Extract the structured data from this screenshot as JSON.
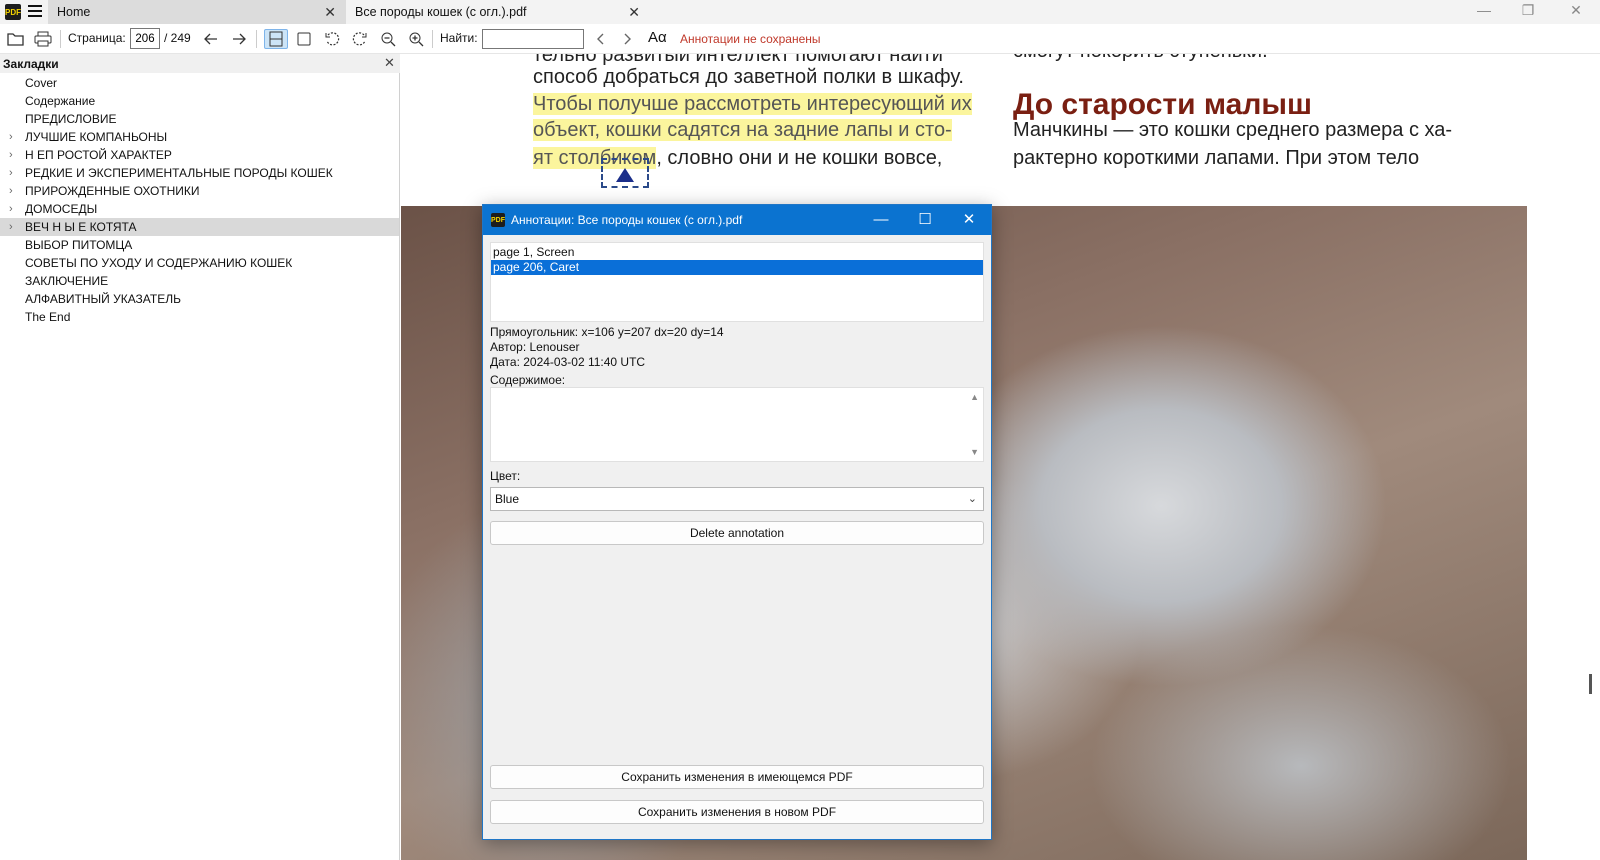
{
  "titlebar": {
    "logo_text": "PDF",
    "tabs": [
      {
        "label": "Home"
      },
      {
        "label": "Все породы кошек (с огл.).pdf"
      }
    ]
  },
  "toolbar": {
    "page_label": "Страница:",
    "page_current": "206",
    "page_total": "/ 249",
    "find_label": "Найти:",
    "find_value": "",
    "font_glyph": "Aα",
    "unsaved_status": "Аннотации не сохранены"
  },
  "sidebar": {
    "title": "Закладки",
    "items": [
      {
        "label": "Cover",
        "expandable": false
      },
      {
        "label": "Содержание",
        "expandable": false
      },
      {
        "label": "ПРЕДИСЛОВИЕ",
        "expandable": false
      },
      {
        "label": "ЛУЧШИЕ КОМПАНЬОНЫ",
        "expandable": true
      },
      {
        "label": "Н ЕП РОСТОЙ ХАРАКТЕР",
        "expandable": true
      },
      {
        "label": "РЕДКИЕ И ЭКСПЕРИМЕНТАЛЬНЫЕ ПОРОДЫ КОШЕК",
        "expandable": true
      },
      {
        "label": "ПРИРОЖДЕННЫЕ ОХОТНИКИ",
        "expandable": true
      },
      {
        "label": "ДОМОСЕДЫ",
        "expandable": true
      },
      {
        "label": "ВЕЧ Н Ы Е КОТЯТА",
        "expandable": true,
        "selected": true
      },
      {
        "label": "ВЫБОР ПИТОМЦА",
        "expandable": false
      },
      {
        "label": "СОВЕТЫ ПО УХОДУ И СОДЕРЖАНИЮ КОШЕК",
        "expandable": false
      },
      {
        "label": "ЗАКЛЮЧЕНИЕ",
        "expandable": false
      },
      {
        "label": "АЛФАВИТНЫЙ УКАЗАТЕЛЬ",
        "expandable": false
      },
      {
        "label": "The End",
        "expandable": false
      }
    ]
  },
  "document": {
    "left_column": [
      "тельно развитый интеллект помогают найти",
      "способ добраться до заветной полки в шкафу."
    ],
    "highlight_lines": [
      "Чтобы получше рассмотреть интересующий их",
      "объект, кошки садятся на задние лапы и сто-",
      "ят столбиком"
    ],
    "after_highlight": ", словно они и не кошки вовсе,",
    "right_top": "смогут покорить ступеньки.",
    "heading": "До старости малыш",
    "right_lines": [
      "Манчкины — это кошки среднего размера с ха-",
      "рактерно короткими лапами. При этом тело"
    ]
  },
  "dialog": {
    "title": "Аннотации: Все породы кошек (с огл.).pdf",
    "annotations": [
      {
        "label": "page 1, Screen",
        "selected": false
      },
      {
        "label": "page 206, Caret",
        "selected": true
      }
    ],
    "rect_text": "Прямоугольник: x=106 y=207 dx=20 dy=14",
    "author_text": "Автор: Lenouser",
    "date_text": "Дата: 2024-03-02 11:40 UTC",
    "content_label": "Содержимое:",
    "content_value": "",
    "color_label": "Цвет:",
    "color_value": "Blue",
    "delete_label": "Delete annotation",
    "save_existing_label": "Сохранить изменения в имеющемся PDF",
    "save_new_label": "Сохранить изменения в новом PDF"
  },
  "colors": {
    "accent": "#0b73d0",
    "selection": "#0a6fd8",
    "highlight": "#fbf59d",
    "heading": "#7a1f12",
    "unsaved": "#c0392b"
  }
}
